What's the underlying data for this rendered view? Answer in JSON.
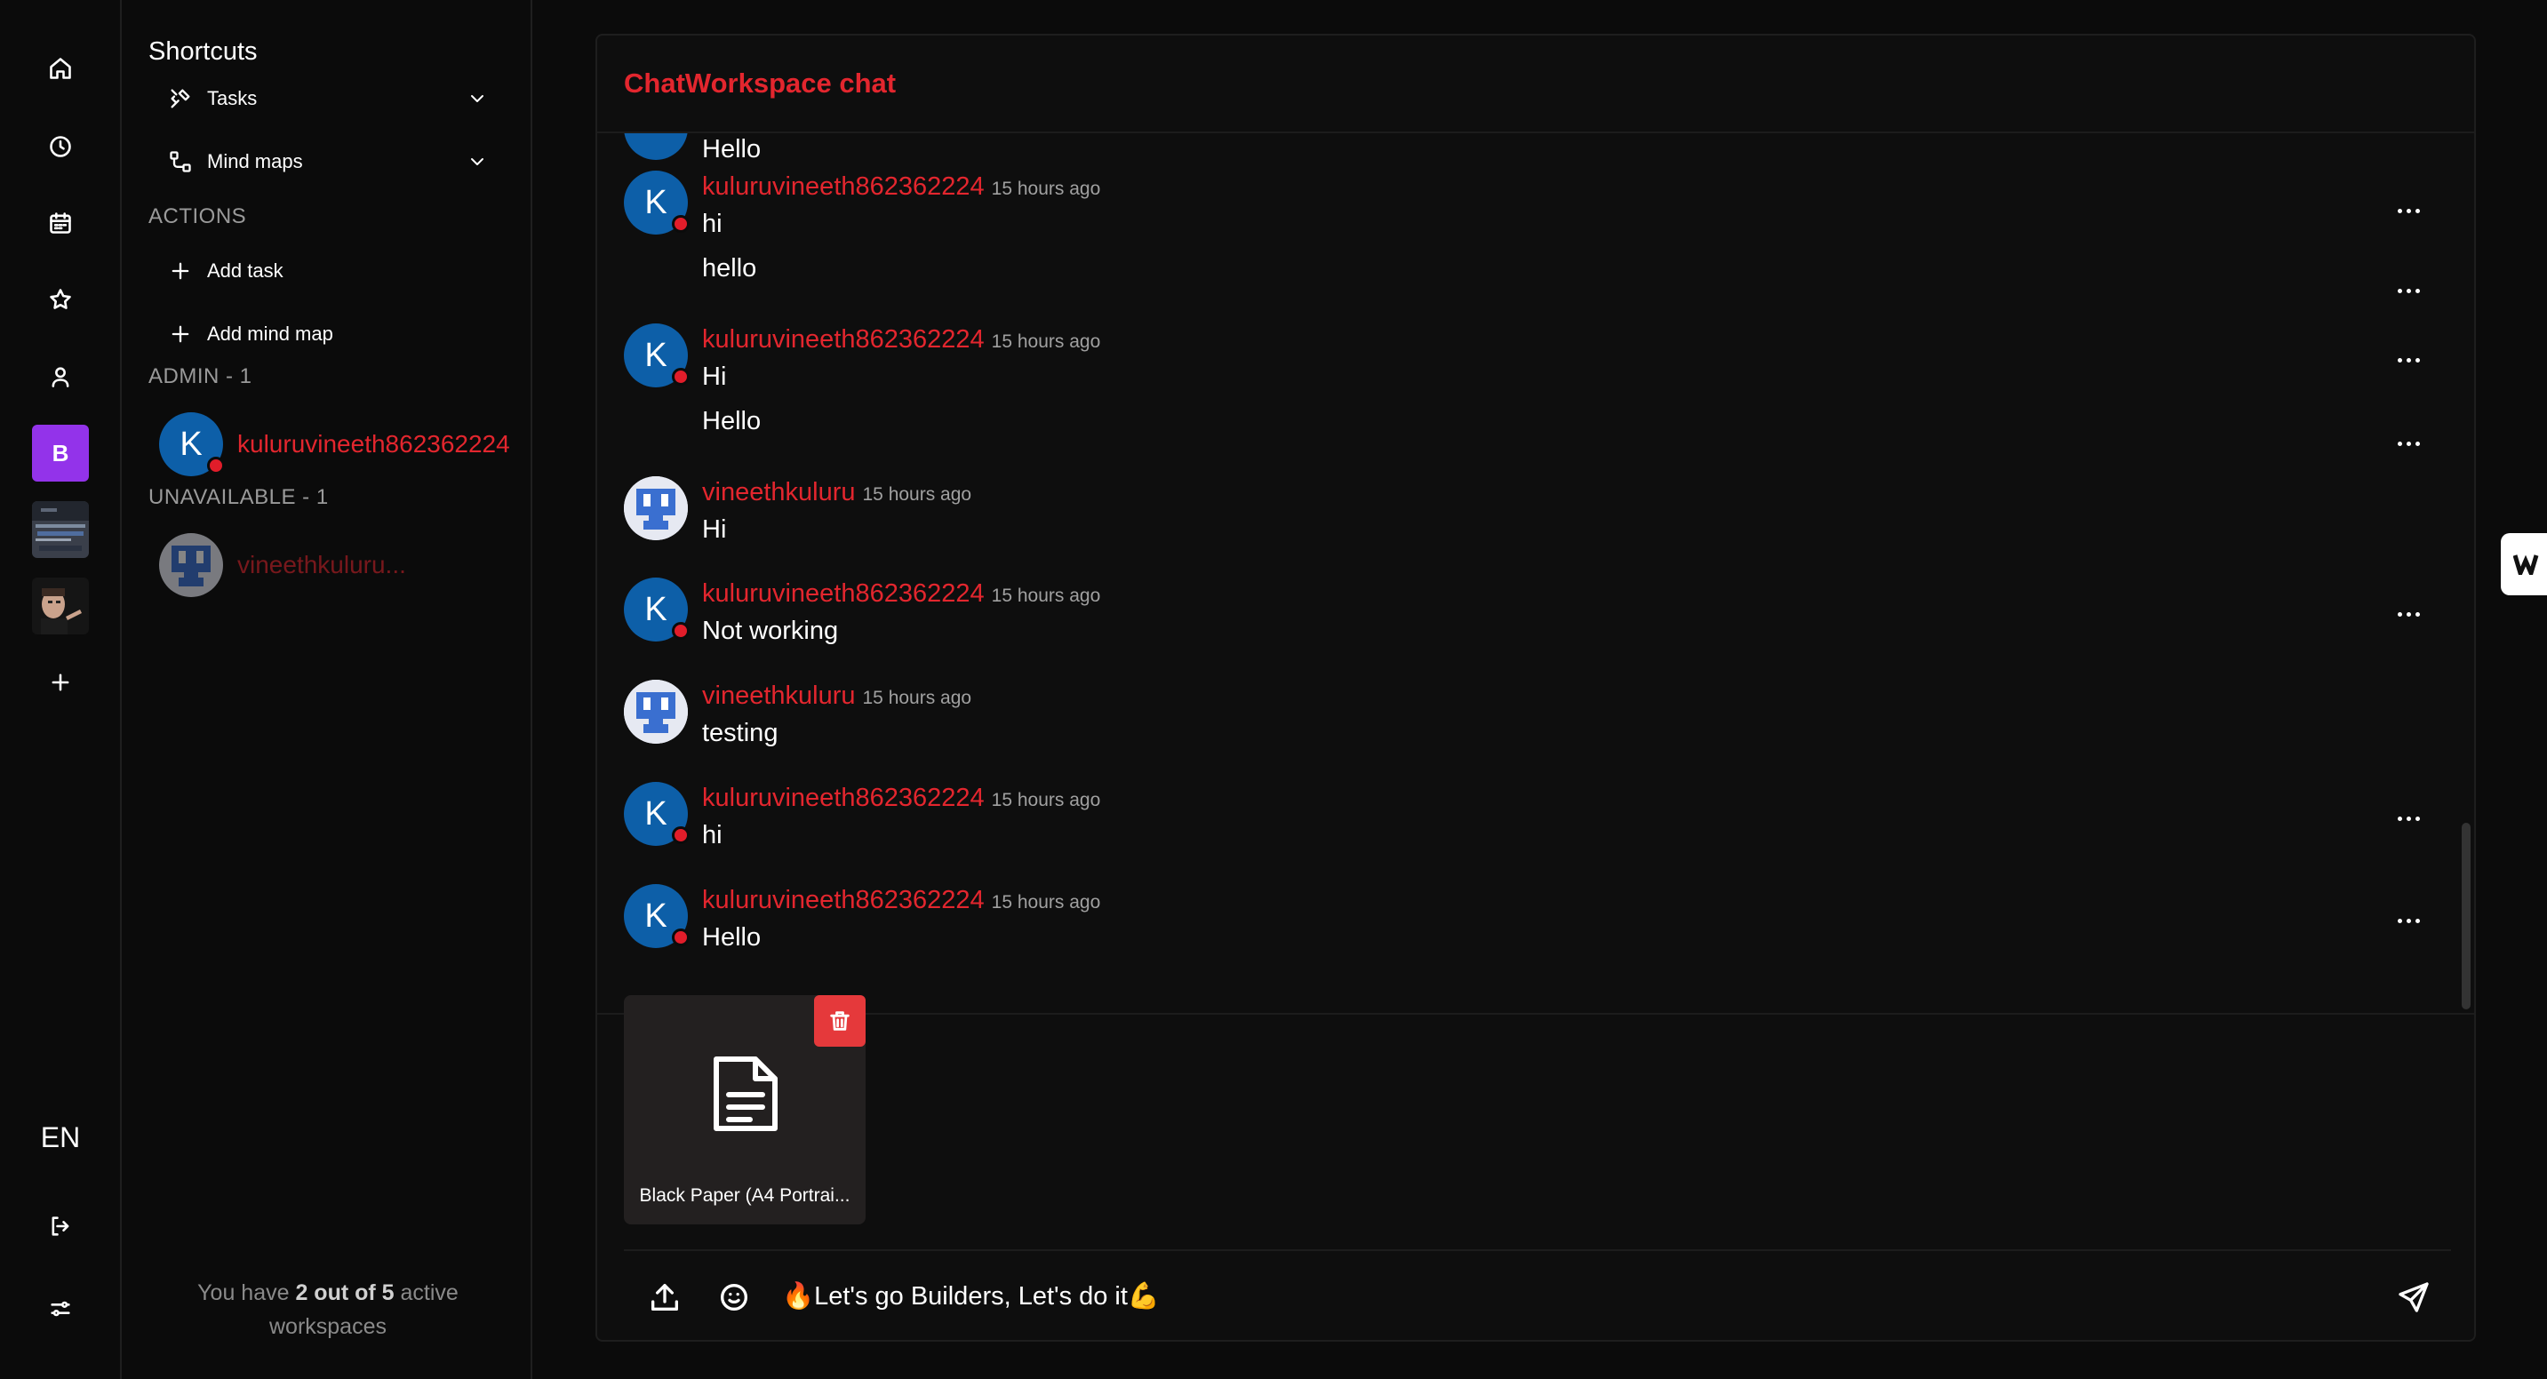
{
  "rail": {
    "items": [
      {
        "icon": "home-icon"
      },
      {
        "icon": "clock-icon"
      },
      {
        "icon": "calendar-icon"
      },
      {
        "icon": "star-icon"
      },
      {
        "icon": "user-icon"
      }
    ],
    "workspace_letter": "B",
    "language": "EN"
  },
  "sidebar": {
    "title": "Shortcuts",
    "shortcuts": [
      {
        "label": "Tasks",
        "icon": "tools-icon"
      },
      {
        "label": "Mind maps",
        "icon": "mindmap-icon"
      }
    ],
    "actions_heading": "ACTIONS",
    "actions": [
      {
        "label": "Add task"
      },
      {
        "label": "Add mind map"
      }
    ],
    "admin_heading": "ADMIN - 1",
    "admin_member": {
      "initial": "K",
      "name": "kuluruvineeth862362224"
    },
    "unavailable_heading": "UNAVAILABLE - 1",
    "unavailable_member": {
      "name": "vineethkuluru..."
    },
    "workspace_note": {
      "prefix": "You have ",
      "count": "2 out of 5",
      "suffix": " active",
      "line2": "workspaces"
    }
  },
  "chat": {
    "title": "ChatWorkspace chat",
    "partial_top_text": "Hello",
    "messages": [
      {
        "avatar": "K",
        "user": "kuluruvineeth862362224",
        "time": "15 hours ago",
        "text": "hi",
        "followup": "hello"
      },
      {
        "avatar": "K",
        "user": "kuluruvineeth862362224",
        "time": "15 hours ago",
        "text": "Hi",
        "followup": "Hello"
      },
      {
        "avatar": "pixel",
        "user": "vineethkuluru",
        "time": "15 hours ago",
        "text": "Hi"
      },
      {
        "avatar": "K",
        "user": "kuluruvineeth862362224",
        "time": "15 hours ago",
        "text": "Not working"
      },
      {
        "avatar": "pixel",
        "user": "vineethkuluru",
        "time": "15 hours ago",
        "text": "testing"
      },
      {
        "avatar": "K",
        "user": "kuluruvineeth862362224",
        "time": "15 hours ago",
        "text": "hi"
      },
      {
        "avatar": "K",
        "user": "kuluruvineeth862362224",
        "time": "15 hours ago",
        "text": "Hello"
      }
    ],
    "attachment": {
      "filename": "Black Paper (A4 Portrai..."
    },
    "composer": {
      "value": "🔥Let's go Builders, Let's do it💪"
    }
  },
  "colors": {
    "accent": "#e3262e",
    "avatar_blue": "#0d5fa8",
    "workspace": "#9333ea",
    "delete": "#e5393b"
  }
}
